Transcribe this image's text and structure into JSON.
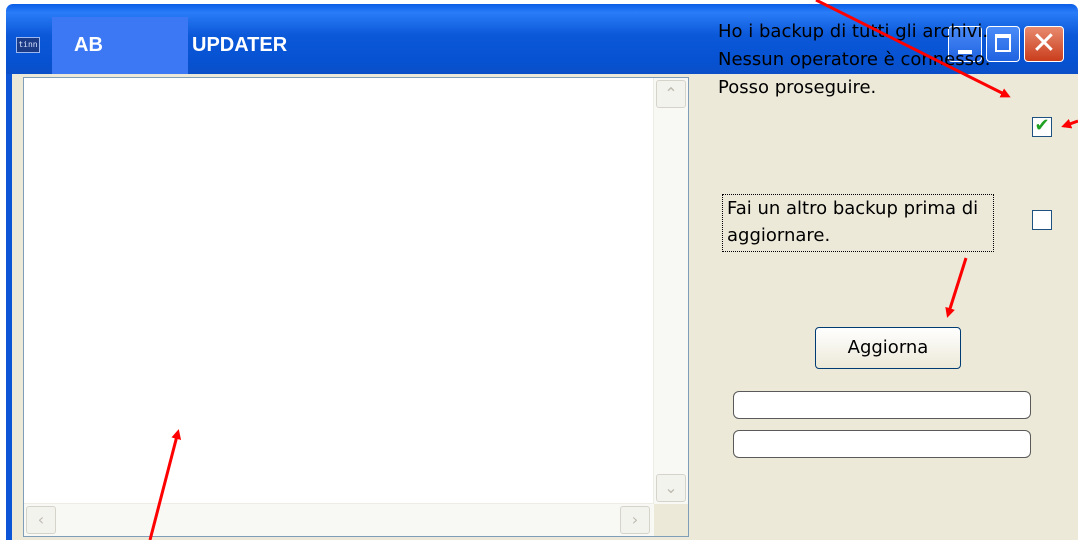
{
  "window": {
    "icon_text": "tinn",
    "ab_label": "AB",
    "title": "UPDATER",
    "minimize_glyph": "",
    "maximize_glyph": "",
    "close_glyph": "✕"
  },
  "log": {
    "text": "",
    "scroll_up": "⌃",
    "scroll_down": "⌄",
    "scroll_left": "‹",
    "scroll_right": "›"
  },
  "confirm": {
    "lines": [
      "Ho i backup di tutti gli archivi.",
      "Nessun operatore è connesso.",
      "Posso proseguire."
    ],
    "checked": true
  },
  "backup": {
    "lines": [
      "Fai un altro backup prima di",
      "aggiornare."
    ],
    "checked": false
  },
  "actions": {
    "update_label": "Aggiorna"
  },
  "status_fields": [
    "",
    ""
  ],
  "annotation_color": "#ff0000"
}
